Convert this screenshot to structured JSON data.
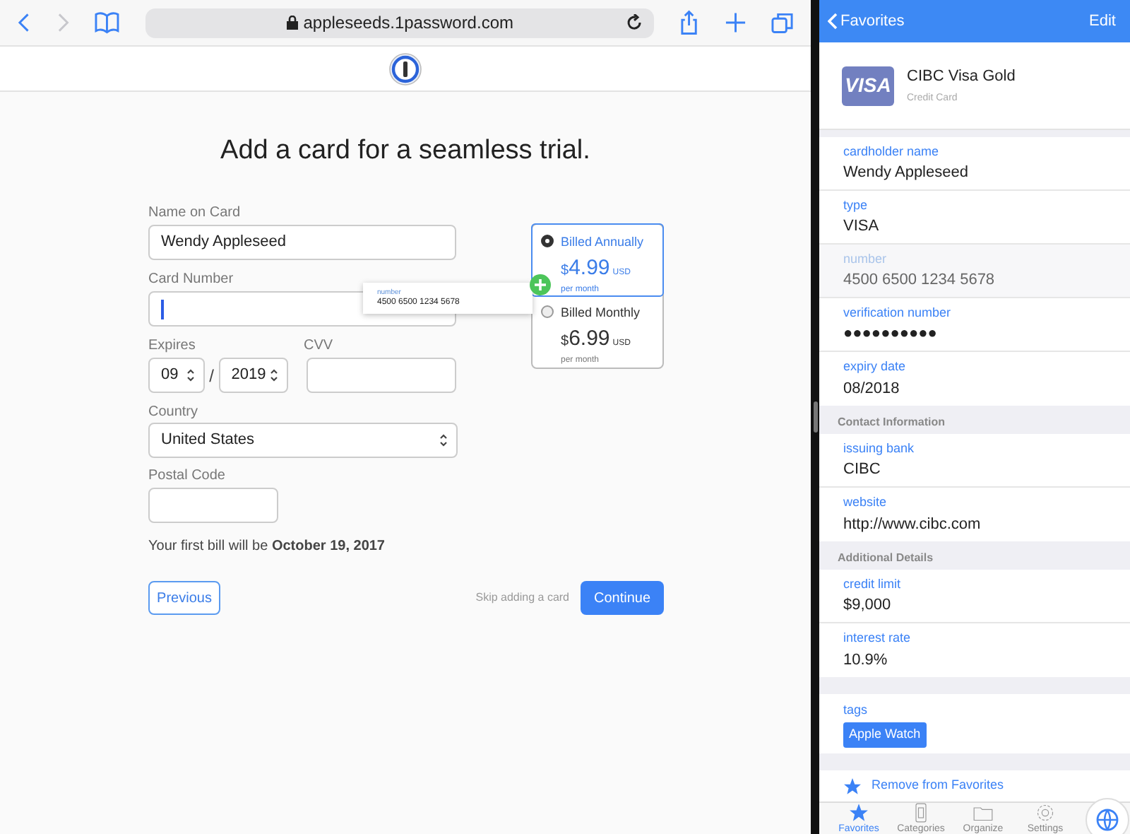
{
  "browser": {
    "url": "appleseeds.1password.com"
  },
  "signup": {
    "heading": "Add a card for a seamless trial.",
    "name_label": "Name on Card",
    "name_value": "Wendy Appleseed",
    "card_label": "Card Number",
    "expires_label": "Expires",
    "month": "09",
    "separator": "/",
    "year": "2019",
    "cvv_label": "CVV",
    "country_label": "Country",
    "country": "United States",
    "postal_label": "Postal Code",
    "first_bill": "Your first bill will be **October 19, 2017**",
    "previous": "Previous",
    "skip": "Skip adding a card",
    "continue": "Continue",
    "plans": [
      {
        "name": "Billed Annually",
        "currency_sign": "$",
        "price": "4.99",
        "currency": "USD",
        "period": "per month",
        "selected": true
      },
      {
        "name": "Billed Monthly",
        "currency_sign": "$",
        "price": "6.99",
        "currency": "USD",
        "period": "per month",
        "selected": false
      }
    ],
    "autofill": {
      "label": "number",
      "value": "4500 6500 1234 5678"
    }
  },
  "item_panel": {
    "back": "Favorites",
    "edit": "Edit",
    "card_logo": "VISA",
    "title": "CIBC Visa Gold",
    "subtitle": "Credit Card",
    "sections": [
      {
        "fields": [
          {
            "label": "cardholder name",
            "value": "Wendy Appleseed",
            "highlighted": false
          },
          {
            "label": "type",
            "value": "VISA",
            "highlighted": false
          },
          {
            "label": "number",
            "value": "4500 6500 1234 5678",
            "highlighted": true
          },
          {
            "label": "verification number",
            "value": "●●●●●●●●●●",
            "highlighted": false
          },
          {
            "label": "expiry date",
            "value": "08/2018",
            "highlighted": false
          }
        ]
      },
      {
        "header": "Contact Information",
        "fields": [
          {
            "label": "issuing bank",
            "value": "CIBC",
            "highlighted": false
          },
          {
            "label": "website",
            "value": "http://www.cibc.com",
            "highlighted": false
          }
        ]
      },
      {
        "header": "Additional Details",
        "fields": [
          {
            "label": "credit limit",
            "value": "$9,000",
            "highlighted": false
          },
          {
            "label": "interest rate",
            "value": "10.9%",
            "highlighted": false
          }
        ]
      }
    ],
    "tags_label": "tags",
    "tags": [
      "Apple Watch"
    ],
    "remove_favorite": "Remove from Favorites",
    "tabs": [
      {
        "label": "Favorites",
        "selected": true
      },
      {
        "label": "Categories",
        "selected": false
      },
      {
        "label": "Organize",
        "selected": false
      },
      {
        "label": "Settings",
        "selected": false
      }
    ]
  }
}
